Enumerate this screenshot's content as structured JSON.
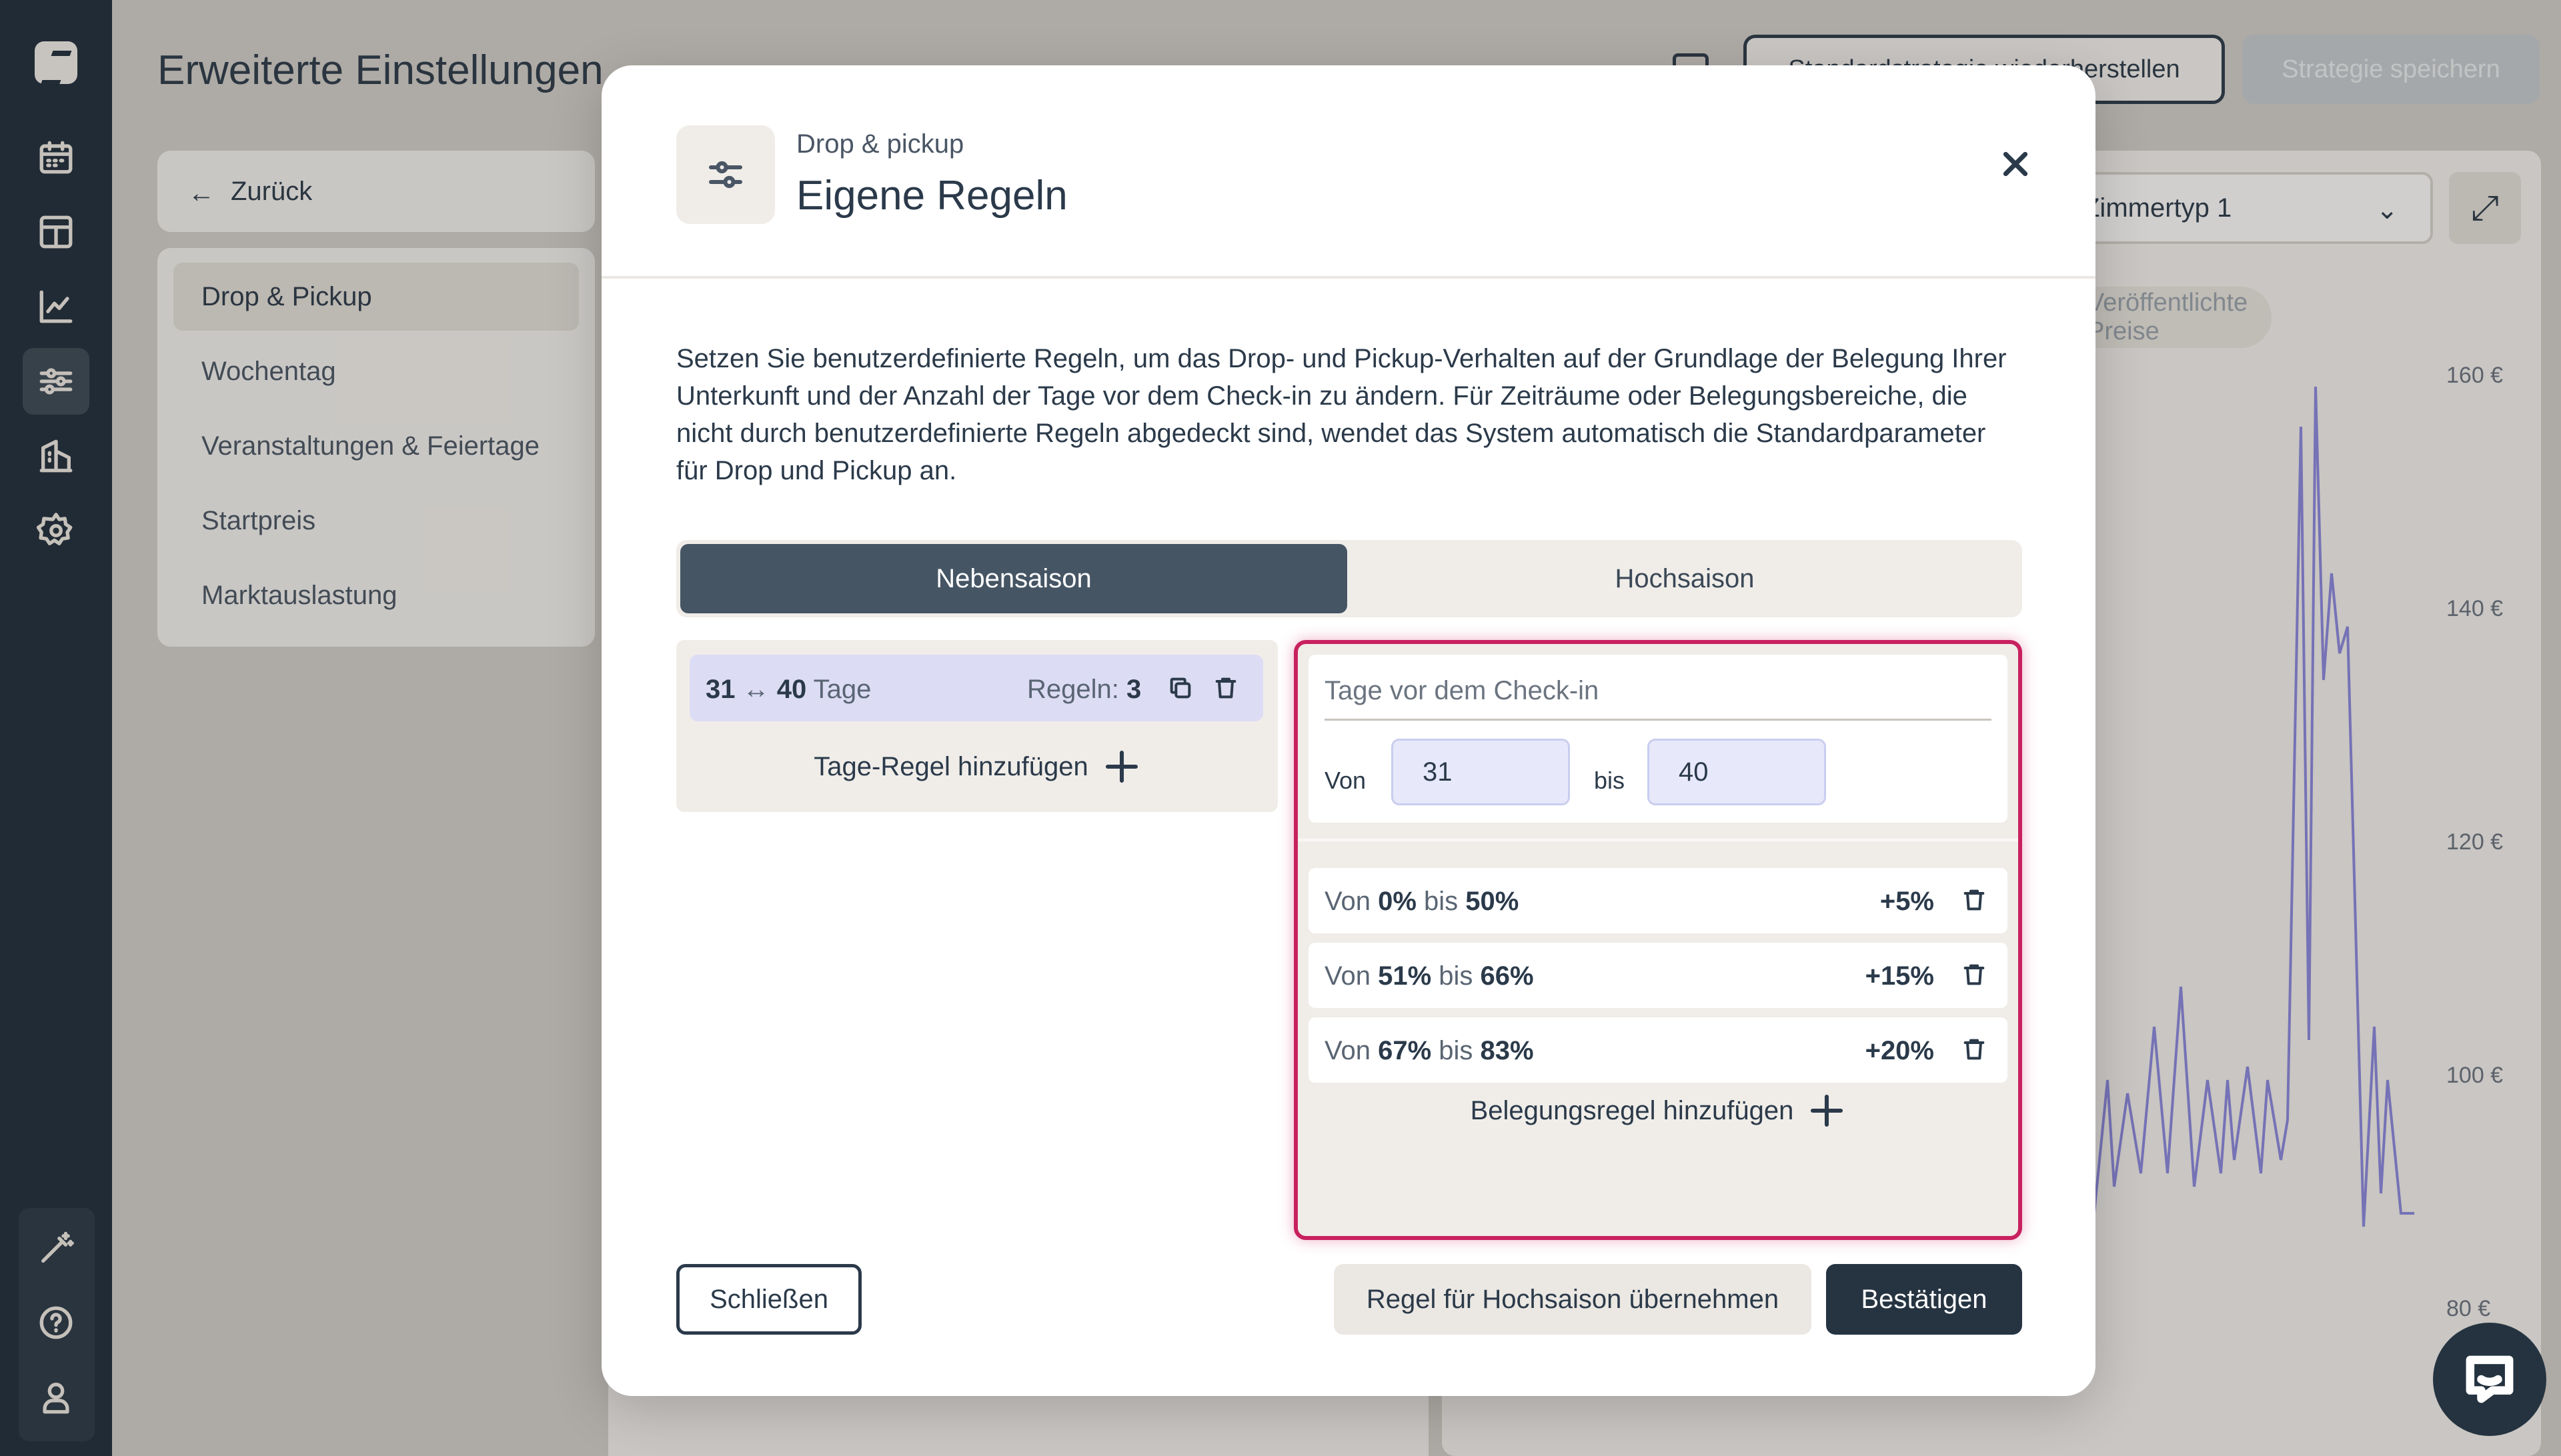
{
  "app": {
    "page_title": "Erweiterte Einstellungen",
    "reset_button": "Standardstrategie wiederherstellen",
    "save_button": "Strategie speichern"
  },
  "sidebar_nav": {
    "back": "Zurück",
    "items": [
      "Drop & Pickup",
      "Wochentag",
      "Veranstaltungen & Feiertage",
      "Startpreis",
      "Marktauslastung"
    ],
    "active_index": 0
  },
  "background_chart": {
    "room_select": "Zimmertyp 1",
    "chip": "Veröffentlichte Preise",
    "y_ticks": [
      "160 €",
      "140 €",
      "120 €",
      "100 €",
      "80 €"
    ]
  },
  "modal": {
    "eyebrow": "Drop & pickup",
    "title": "Eigene Regeln",
    "description": "Setzen Sie benutzerdefinierte Regeln, um das Drop- und Pickup-Verhalten auf der Grundlage der Belegung Ihrer Unterkunft und der Anzahl der Tage vor dem Check-in zu ändern. Für Zeiträume oder Belegungsbereiche, die nicht durch benutzerdefinierte Regeln abgedeckt sind, wendet das System automatisch die Standardparameter für Drop und Pickup an.",
    "tabs": [
      "Nebensaison",
      "Hochsaison"
    ],
    "active_tab": 0,
    "day_rules": [
      {
        "from": "31",
        "arrow": "↔",
        "to": "40",
        "unit": "Tage",
        "rules_label": "Regeln:",
        "rules_count": "3"
      }
    ],
    "add_day_rule": "Tage-Regel hinzufügen",
    "days_editor": {
      "label": "Tage vor dem Check-in",
      "from_label": "Von",
      "to_label": "bis",
      "from_value": "31",
      "to_value": "40"
    },
    "occupancy_rules": [
      {
        "von": "Von",
        "from": "0%",
        "bis": "bis",
        "to": "50%",
        "adjust": "+5%"
      },
      {
        "von": "Von",
        "from": "51%",
        "bis": "bis",
        "to": "66%",
        "adjust": "+15%"
      },
      {
        "von": "Von",
        "from": "67%",
        "bis": "bis",
        "to": "83%",
        "adjust": "+20%"
      }
    ],
    "add_occupancy_rule": "Belegungsregel hinzufügen",
    "buttons": {
      "close": "Schließen",
      "apply_high_season": "Regel für Hochsaison übernehmen",
      "confirm": "Bestätigen"
    }
  },
  "colors": {
    "rail": "#1f2d3b",
    "accent_highlight": "#c8215f",
    "active_tab": "#455564",
    "primary_button": "#263442",
    "selected_row": "#dcdcf5",
    "chart_line": "#8b88e0"
  }
}
